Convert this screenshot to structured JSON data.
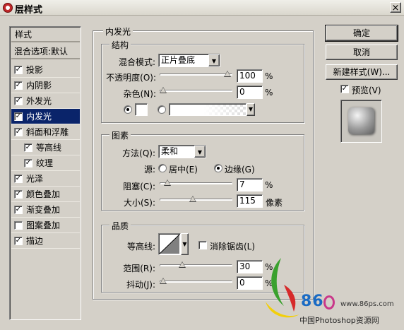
{
  "window": {
    "title": "层样式",
    "close_glyph": "×"
  },
  "styles_list": {
    "header": "样式",
    "blend_options": "混合选项:默认",
    "items": [
      {
        "label": "投影",
        "checked": true
      },
      {
        "label": "内阴影",
        "checked": true
      },
      {
        "label": "外发光",
        "checked": true
      },
      {
        "label": "内发光",
        "checked": true,
        "active": true
      },
      {
        "label": "斜面和浮雕",
        "checked": true
      },
      {
        "label": "等高线",
        "checked": true,
        "sub": true
      },
      {
        "label": "纹理",
        "checked": true,
        "sub": true
      },
      {
        "label": "光泽",
        "checked": true
      },
      {
        "label": "颜色叠加",
        "checked": true
      },
      {
        "label": "渐变叠加",
        "checked": true
      },
      {
        "label": "图案叠加",
        "checked": false
      },
      {
        "label": "描边",
        "checked": true
      }
    ]
  },
  "inner_glow": {
    "title": "内发光",
    "structure": {
      "title": "结构",
      "blend_mode_label": "混合模式:",
      "blend_mode_value": "正片叠底",
      "opacity_label": "不透明度(O):",
      "opacity_value": "100",
      "opacity_level": 1.0,
      "noise_label": "杂色(N):",
      "noise_value": "0",
      "noise_level": 0.0,
      "percent": "%"
    },
    "elements": {
      "title": "图素",
      "method_label": "方法(Q):",
      "method_value": "柔和",
      "source_label": "源:",
      "source_center": "居中(E)",
      "source_edge": "边缘(G)",
      "source_selected": "edge",
      "choke_label": "阻塞(C):",
      "choke_value": "7",
      "choke_level": 0.07,
      "size_label": "大小(S):",
      "size_value": "115",
      "size_level": 0.46,
      "size_unit": "像素",
      "percent": "%"
    },
    "quality": {
      "title": "品质",
      "contour_label": "等高线:",
      "antialias_label": "消除锯齿(L)",
      "antialias_checked": false,
      "range_label": "范围(R):",
      "range_value": "30",
      "range_level": 0.3,
      "jitter_label": "抖动(J):",
      "jitter_value": "0",
      "jitter_level": 0.0,
      "percent": "%"
    }
  },
  "buttons": {
    "ok": "确定",
    "cancel": "取消",
    "new_style": "新建样式(W)...",
    "preview_label": "预览(V)",
    "preview_checked": true
  },
  "watermark": {
    "url": "www.86ps.com",
    "logo_text": "86",
    "caption": "中国Photoshop资源网"
  },
  "colors": {
    "active_item": "#0a246a",
    "dialog_bg": "#d4d0c8"
  }
}
